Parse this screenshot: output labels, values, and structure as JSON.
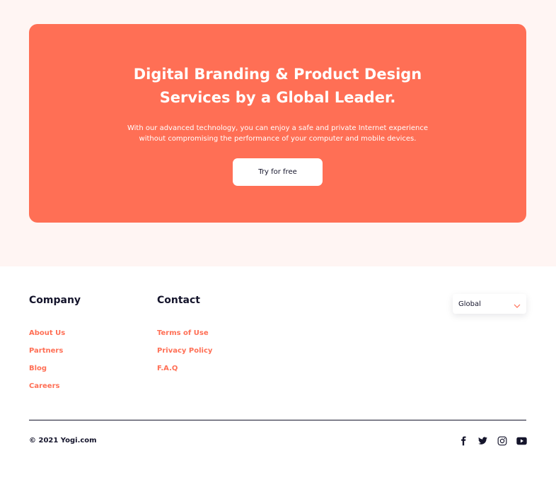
{
  "hero": {
    "title": "Digital Branding & Product Design Services by a Global Leader.",
    "subtitle": "With our advanced technology, you can enjoy a safe and private Internet experience without compromising the performance of your computer and mobile devices.",
    "cta_label": "Try for free"
  },
  "footer": {
    "company": {
      "heading": "Company",
      "links": [
        "About Us",
        "Partners",
        "Blog",
        "Careers"
      ]
    },
    "contact": {
      "heading": "Contact",
      "links": [
        "Terms of Use",
        "Privacy Policy",
        "F.A.Q"
      ]
    },
    "region": {
      "selected": "Global"
    },
    "copyright": "© 2021 Yogi.com",
    "social": [
      "facebook-icon",
      "twitter-icon",
      "instagram-icon",
      "youtube-icon"
    ]
  },
  "colors": {
    "accent": "#ff6f55",
    "text_dark": "#14142b",
    "background_tint": "#fff5f3"
  }
}
